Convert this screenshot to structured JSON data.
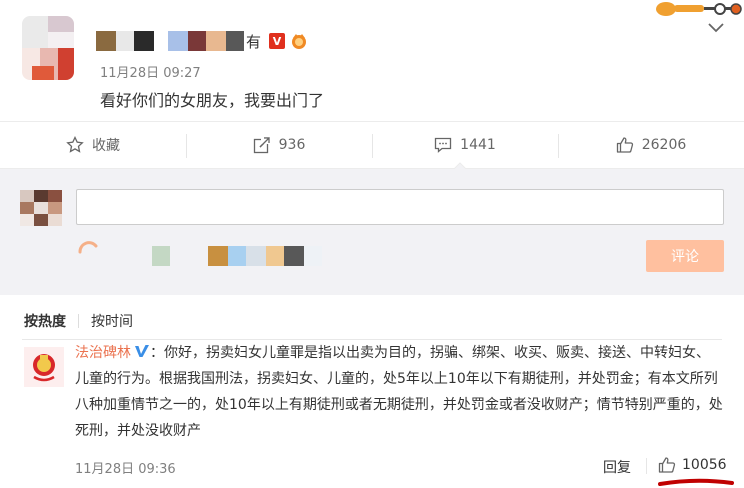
{
  "post": {
    "author_tail": "有",
    "vip_badge": "V",
    "time": "11月28日 09:27",
    "text": "看好你们的女朋友，我要出门了"
  },
  "actions": {
    "favorite_label": "收藏",
    "repost_count": "936",
    "comment_count": "1441",
    "like_count": "26206"
  },
  "composer": {
    "input_value": "",
    "submit_label": "评论"
  },
  "sort": {
    "hot_label": "按热度",
    "time_label": "按时间"
  },
  "comment": {
    "username": "法治碑林",
    "text": "：你好，拐卖妇女儿童罪是指以出卖为目的，拐骗、绑架、收买、贩卖、接送、中转妇女、儿童的行为。根据我国刑法，拐卖妇女、儿童的，处5年以上10年以下有期徒刑，并处罚金；有本文所列八种加重情节之一的，处10年以上有期徒刑或者无期徒刑，并处罚金或者没收财产；情节特别严重的，处死刑，并处没收财产",
    "time": "11月28日 09:36",
    "reply_label": "回复",
    "like_count": "10056"
  },
  "colors": {
    "accent_orange": "#eb7350",
    "comment_button": "#ffc09f",
    "verified_blue": "#3a8ee6"
  }
}
